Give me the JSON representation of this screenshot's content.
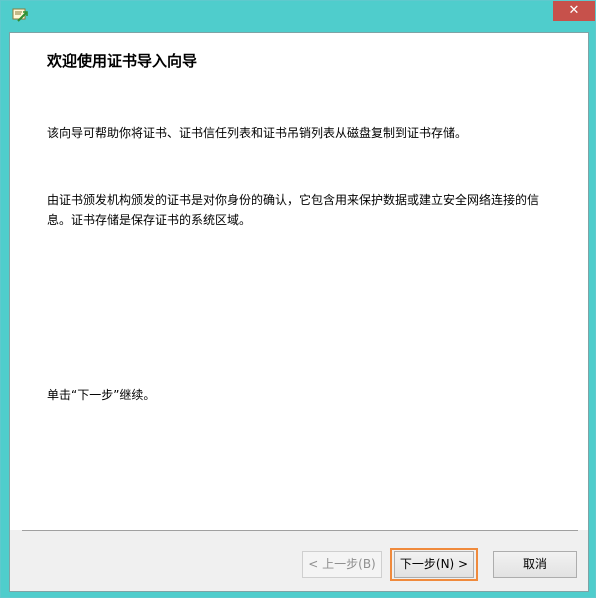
{
  "wizard": {
    "title": "欢迎使用证书导入向导",
    "paragraph1": "该向导可帮助你将证书、证书信任列表和证书吊销列表从磁盘复制到证书存储。",
    "paragraph2": "由证书颁发机构颁发的证书是对你身份的确认，它包含用来保护数据或建立安全网络连接的信息。证书存储是保存证书的系统区域。",
    "paragraph3": "单击“下一步”继续。"
  },
  "buttons": {
    "back": "< 上一步(B)",
    "next": "下一步(N) >",
    "cancel": "取消",
    "close": "✕"
  },
  "colors": {
    "frame": "#4fcdcc",
    "close": "#c7514b",
    "focus_outline": "#f08a3c"
  }
}
